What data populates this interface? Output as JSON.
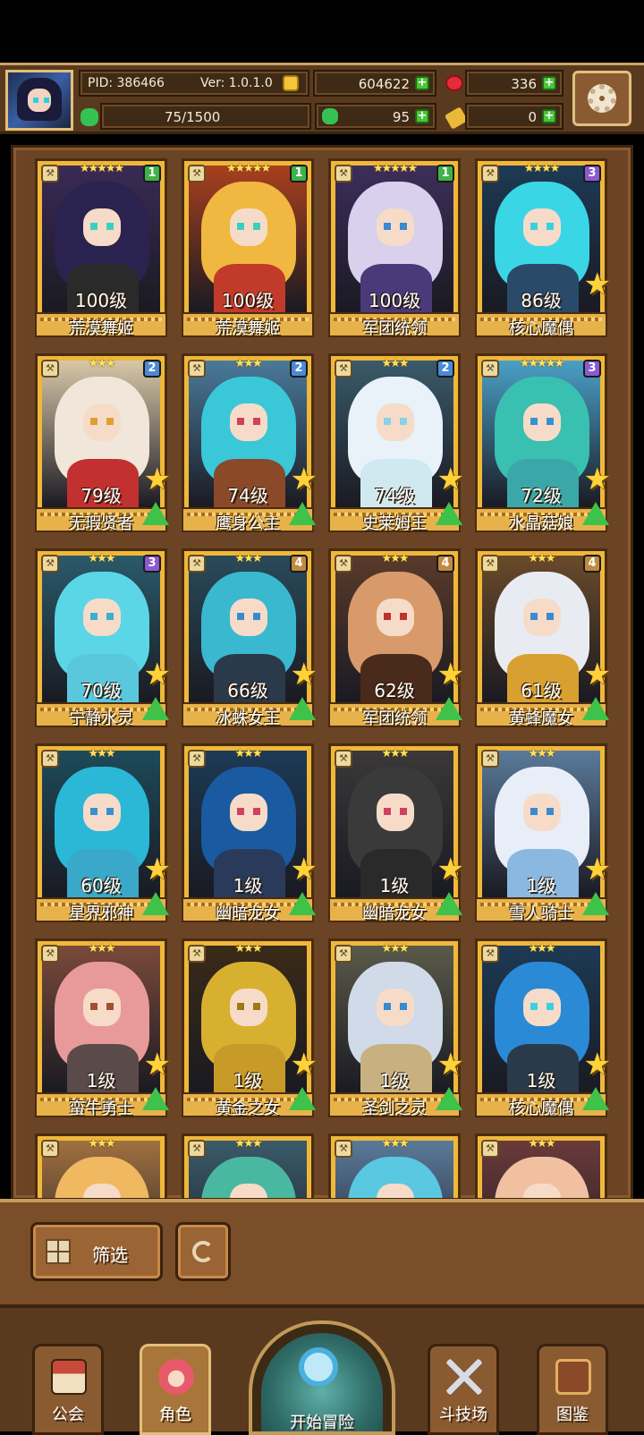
{
  "header": {
    "pid": "PID: 386466",
    "version": "Ver: 1.0.1.0",
    "gold": "604622",
    "ruby": "336",
    "stamina": "75/1500",
    "clover": "95",
    "key": "0"
  },
  "heroes": [
    {
      "level": "100级",
      "name": "荒漠舞姬",
      "rank": "1",
      "stars": "★★★★★",
      "rank_color": "#3fb24a",
      "hair": "#2a2350",
      "skin_accent": "#3ad0c0",
      "body": "#2a2a2a",
      "bg": "#3a2a55",
      "show_star": false,
      "show_arrow": false
    },
    {
      "level": "100级",
      "name": "荒漠舞姬",
      "rank": "1",
      "stars": "★★★★★",
      "rank_color": "#3fb24a",
      "hair": "#f0b840",
      "skin_accent": "#3ad0c0",
      "body": "#c23a2a",
      "bg": "#a8401e",
      "show_star": false,
      "show_arrow": false
    },
    {
      "level": "100级",
      "name": "军团统领",
      "rank": "1",
      "stars": "★★★★★",
      "rank_color": "#3fb24a",
      "hair": "#d8d0ec",
      "skin_accent": "#3a8ad0",
      "body": "#4a3a7a",
      "bg": "#3d2e5a",
      "show_star": false,
      "show_arrow": false
    },
    {
      "level": "86级",
      "name": "核心魔偶",
      "rank": "3",
      "stars": "★★★★",
      "rank_color": "#8a5ad0",
      "hair": "#3ad6e6",
      "skin_accent": "#3ad0e0",
      "body": "#2a4a6a",
      "bg": "#1d3a55",
      "show_star": true,
      "show_arrow": false
    },
    {
      "level": "79级",
      "name": "无瑕贤者",
      "rank": "2",
      "stars": "★★★",
      "rank_color": "#4a8ad6",
      "hair": "#f0e6da",
      "skin_accent": "#e0a030",
      "body": "#c23030",
      "bg": "#d8c8a8",
      "show_star": true,
      "show_arrow": true
    },
    {
      "level": "74级",
      "name": "鹰身公主",
      "rank": "2",
      "stars": "★★★",
      "rank_color": "#4a8ad6",
      "hair": "#3ac8d8",
      "skin_accent": "#d04060",
      "body": "#8a4a2a",
      "bg": "#4a7a9a",
      "show_star": true,
      "show_arrow": true
    },
    {
      "level": "74级",
      "name": "史莱姆王",
      "rank": "2",
      "stars": "★★★",
      "rank_color": "#4a8ad6",
      "hair": "#e8f2f8",
      "skin_accent": "#8ad0e8",
      "body": "#d0e8f0",
      "bg": "#3a5a6a",
      "show_star": true,
      "show_arrow": true
    },
    {
      "level": "72级",
      "name": "水晶菇娘",
      "rank": "3",
      "stars": "★★★★★",
      "rank_color": "#8a5ad0",
      "hair": "#3ac0b0",
      "skin_accent": "#3a90d0",
      "body": "#3aa8a8",
      "bg": "#4aa0c8",
      "show_star": true,
      "show_arrow": true
    },
    {
      "level": "70级",
      "name": "宁静水灵",
      "rank": "3",
      "stars": "★★★",
      "rank_color": "#8a5ad0",
      "hair": "#5ad6e6",
      "skin_accent": "#3ab0d0",
      "body": "#5ac8dc",
      "bg": "#2a5a6a",
      "show_star": true,
      "show_arrow": true
    },
    {
      "level": "66级",
      "name": "冰蛛女王",
      "rank": "4",
      "stars": "★★★",
      "rank_color": "#c08a40",
      "hair": "#3ab8d0",
      "skin_accent": "#3a8ad0",
      "body": "#2a3a4a",
      "bg": "#2a4a5a",
      "show_star": true,
      "show_arrow": true
    },
    {
      "level": "62级",
      "name": "军团统领",
      "rank": "4",
      "stars": "★★★",
      "rank_color": "#c08a40",
      "hair": "#d89a6a",
      "skin_accent": "#c03030",
      "body": "#4a2a1a",
      "bg": "#5a3a2a",
      "show_star": true,
      "show_arrow": true
    },
    {
      "level": "61级",
      "name": "黄蜂魔女",
      "rank": "4",
      "stars": "★★★",
      "rank_color": "#c08a40",
      "hair": "#e8ecf2",
      "skin_accent": "#3a8ad0",
      "body": "#d8a030",
      "bg": "#6a4a2a",
      "show_star": true,
      "show_arrow": true
    },
    {
      "level": "60级",
      "name": "星界邪神",
      "rank": "",
      "stars": "★★★",
      "rank_color": "",
      "hair": "#2ab8d6",
      "skin_accent": "#3a90d0",
      "body": "#3aa8c8",
      "bg": "#1d4a5a",
      "show_star": true,
      "show_arrow": true
    },
    {
      "level": "1级",
      "name": "幽暗龙女",
      "rank": "",
      "stars": "★★★",
      "rank_color": "",
      "hair": "#1a5aa0",
      "skin_accent": "#d04060",
      "body": "#2a3a5a",
      "bg": "#1d3a55",
      "show_star": true,
      "show_arrow": true
    },
    {
      "level": "1级",
      "name": "幽暗龙女",
      "rank": "",
      "stars": "★★★",
      "rank_color": "",
      "hair": "#3a3a3a",
      "skin_accent": "#d04060",
      "body": "#2a2a2a",
      "bg": "#3a3838",
      "show_star": true,
      "show_arrow": true
    },
    {
      "level": "1级",
      "name": "雪人骑士",
      "rank": "",
      "stars": "★★★",
      "rank_color": "",
      "hair": "#e8eef8",
      "skin_accent": "#3a8ad0",
      "body": "#8ab8e0",
      "bg": "#5a7a9a",
      "show_star": true,
      "show_arrow": true
    },
    {
      "level": "1级",
      "name": "蛮牛勇士",
      "rank": "",
      "stars": "★★★",
      "rank_color": "",
      "hair": "#e89a9a",
      "skin_accent": "#a05030",
      "body": "#5a4a4a",
      "bg": "#7a4a3a",
      "show_star": true,
      "show_arrow": true
    },
    {
      "level": "1级",
      "name": "黄金之女",
      "rank": "",
      "stars": "★★★",
      "rank_color": "",
      "hair": "#d8b030",
      "skin_accent": "#a07818",
      "body": "#c89a28",
      "bg": "#3a2a18",
      "show_star": true,
      "show_arrow": true
    },
    {
      "level": "1级",
      "name": "圣剑之灵",
      "rank": "",
      "stars": "★★★",
      "rank_color": "",
      "hair": "#d0dae8",
      "skin_accent": "#3a8ad0",
      "body": "#c8b080",
      "bg": "#5a5a4a",
      "show_star": true,
      "show_arrow": true
    },
    {
      "level": "1级",
      "name": "核心魔偶",
      "rank": "",
      "stars": "★★★",
      "rank_color": "",
      "hair": "#2a8ad6",
      "skin_accent": "#3ad0e0",
      "body": "#2a3a4a",
      "bg": "#1d3a55",
      "show_star": true,
      "show_arrow": true
    },
    {
      "level": "",
      "name": "",
      "rank": "",
      "stars": "★★★",
      "rank_color": "",
      "hair": "#f0b860",
      "skin_accent": "#d04060",
      "body": "#c89a5a",
      "bg": "#a07040",
      "show_star": false,
      "show_arrow": false
    },
    {
      "level": "",
      "name": "",
      "rank": "",
      "stars": "★★★",
      "rank_color": "",
      "hair": "#4ab8a0",
      "skin_accent": "#d04060",
      "body": "#3a6a5a",
      "bg": "#3a5a6a",
      "show_star": false,
      "show_arrow": false
    },
    {
      "level": "",
      "name": "",
      "rank": "",
      "stars": "★★★",
      "rank_color": "",
      "hair": "#5ac8e0",
      "skin_accent": "#3a8ad0",
      "body": "#e8c040",
      "bg": "#5a7a9a",
      "show_star": false,
      "show_arrow": false
    },
    {
      "level": "",
      "name": "",
      "rank": "",
      "stars": "★★★",
      "rank_color": "",
      "hair": "#f0c0a0",
      "skin_accent": "#d04060",
      "body": "#c84050",
      "bg": "#6a3a3a",
      "show_star": false,
      "show_arrow": false
    }
  ],
  "controls": {
    "filter_label": "筛选"
  },
  "nav": {
    "guild": "公会",
    "character": "角色",
    "start": "开始冒险",
    "arena": "斗技场",
    "codex": "图鉴"
  }
}
